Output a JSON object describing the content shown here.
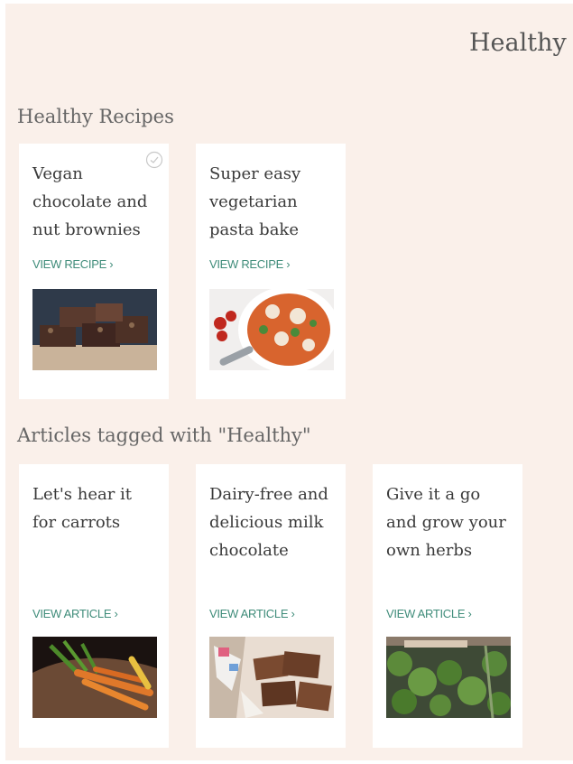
{
  "page": {
    "title": "Healthy"
  },
  "recipes": {
    "heading": "Healthy Recipes",
    "cards": [
      {
        "title": "Vegan chocolate and nut brownies",
        "link": "VIEW RECIPE ›",
        "image": "brownies-photo"
      },
      {
        "title": "Super easy vegetarian pasta bake",
        "link": "VIEW RECIPE ›",
        "image": "pasta-bake-photo"
      }
    ]
  },
  "articles": {
    "heading": "Articles tagged with \"Healthy\"",
    "cards": [
      {
        "title": "Let's hear it for carrots",
        "link": "VIEW ARTICLE ›",
        "image": "carrots-photo"
      },
      {
        "title": "Dairy-free and delicious milk chocolate",
        "link": "VIEW ARTICLE ›",
        "image": "chocolate-photo"
      },
      {
        "title": "Give it a go and grow your own herbs",
        "link": "VIEW ARTICLE ›",
        "image": "herbs-photo"
      }
    ]
  },
  "icons": {
    "save": "check-circle-icon"
  }
}
